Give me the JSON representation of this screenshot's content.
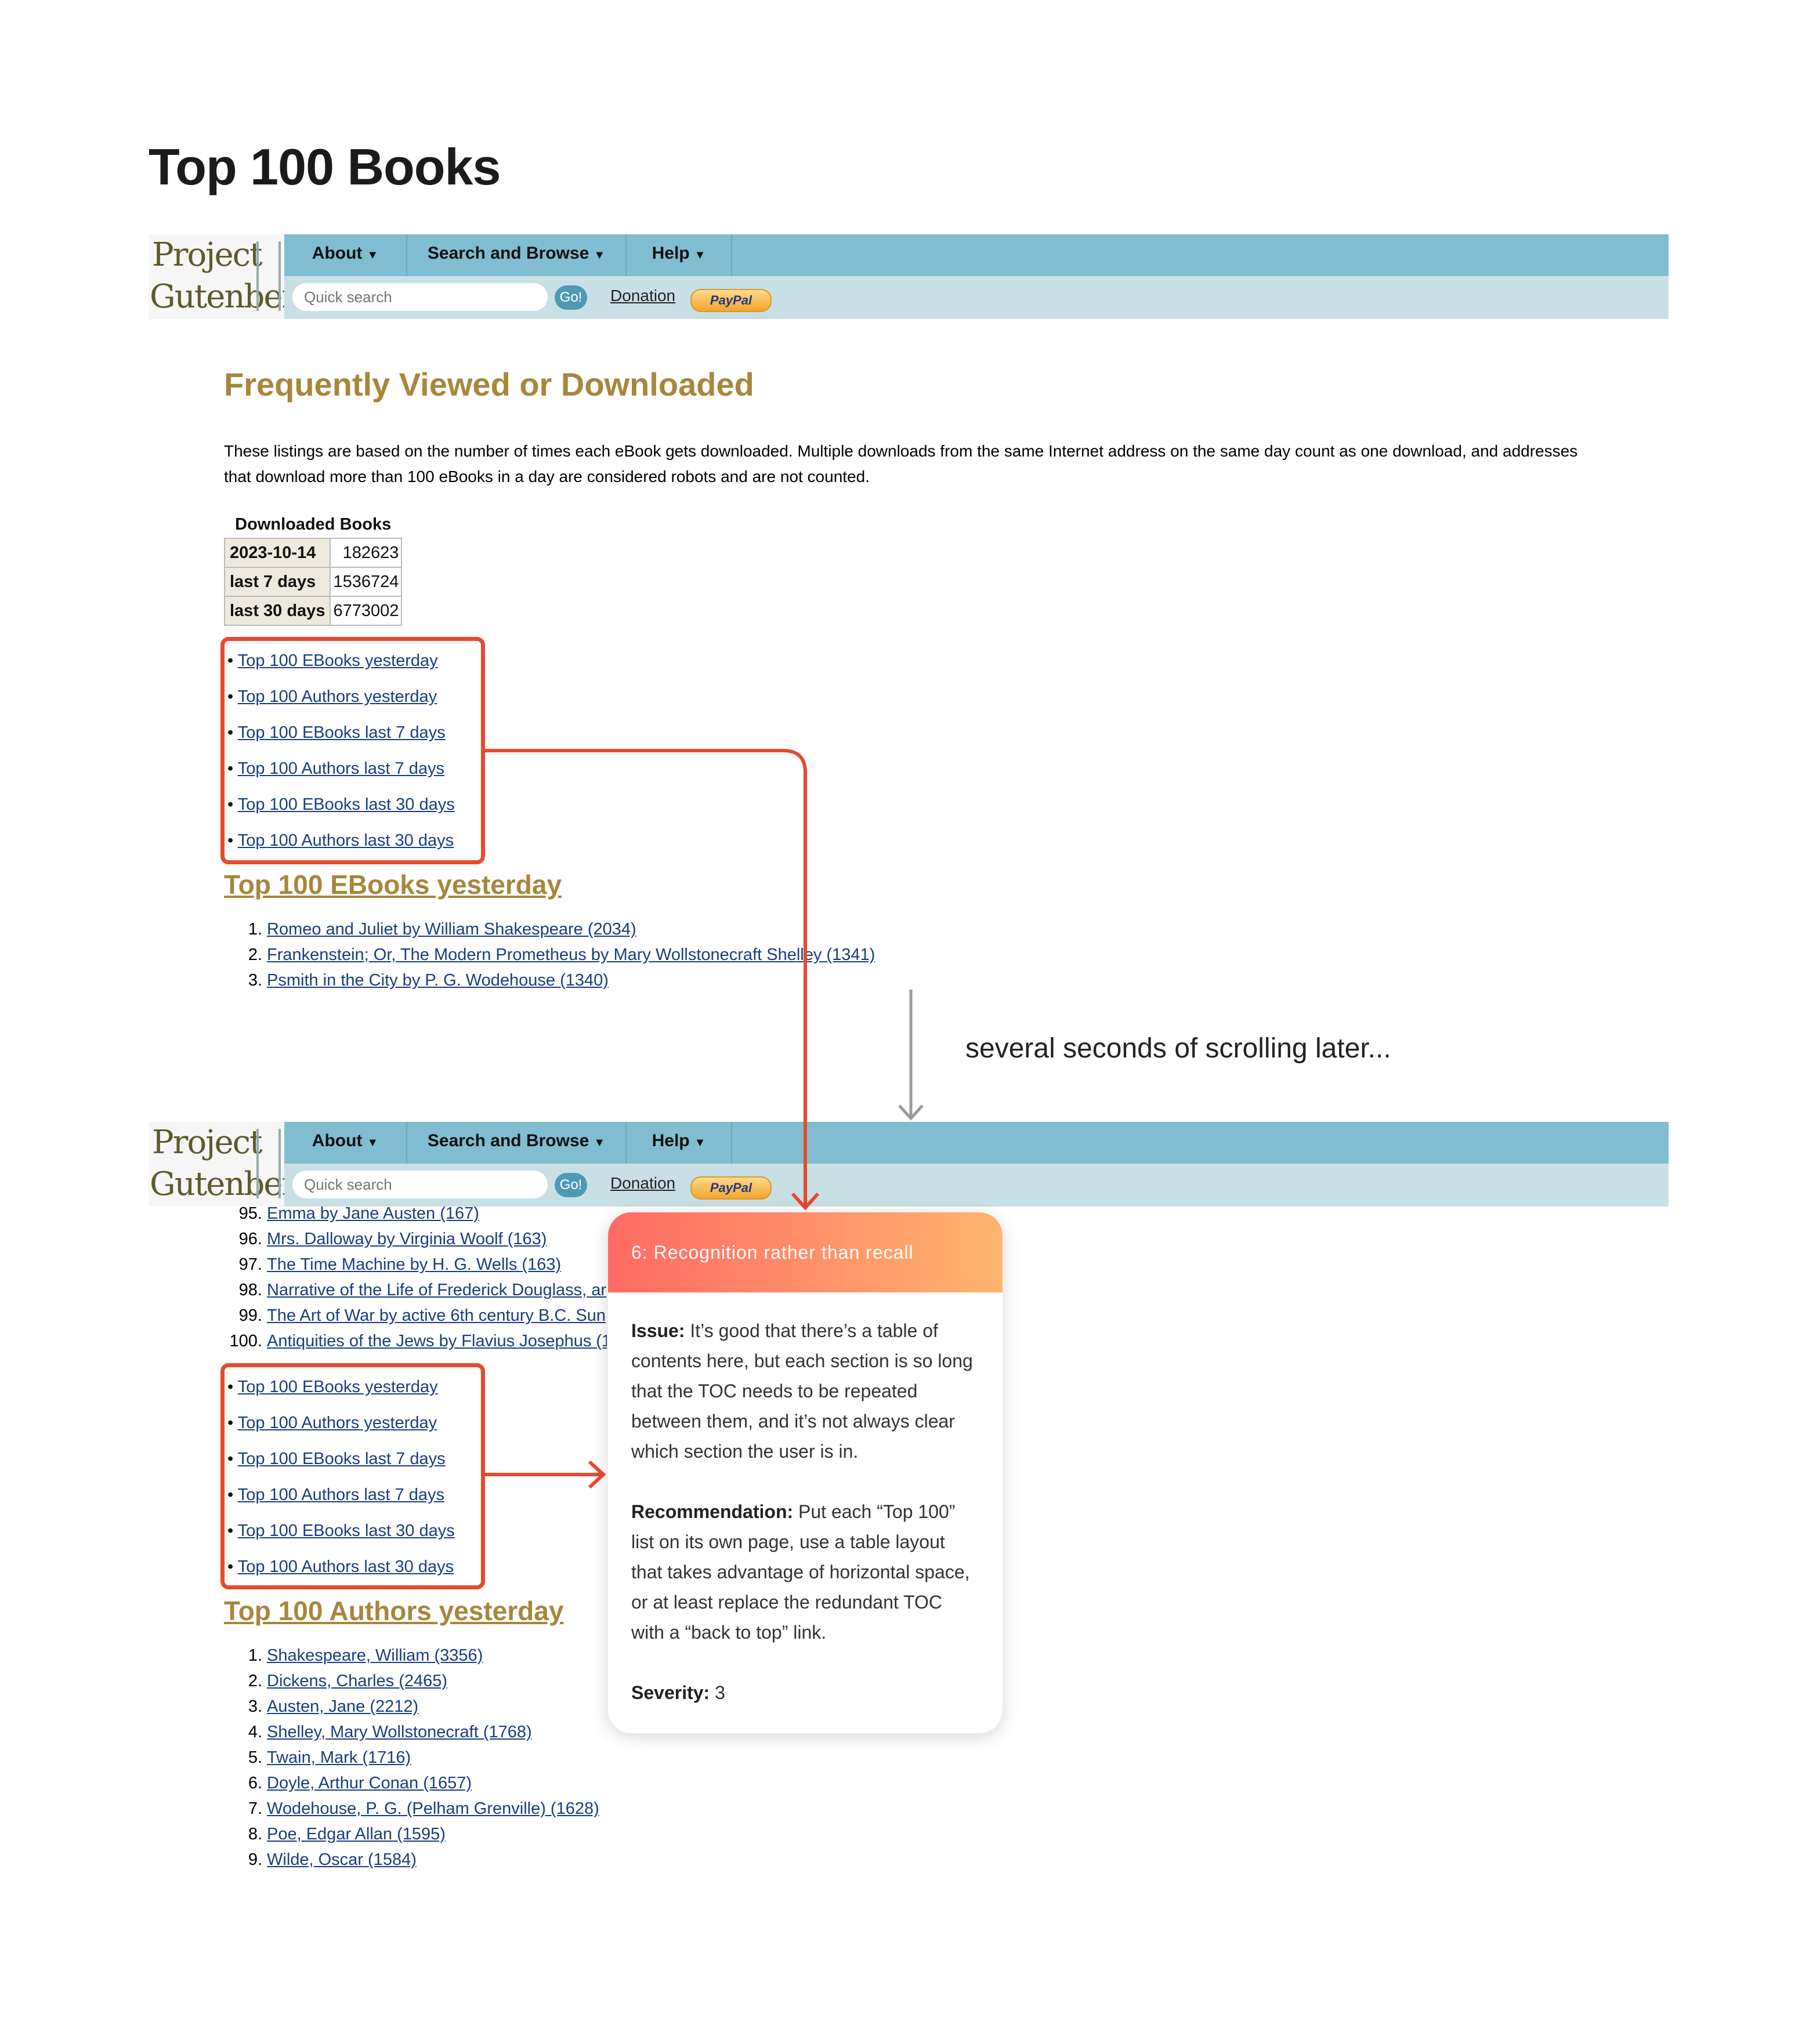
{
  "page_title": "Top 100 Books",
  "gutenberg": {
    "logo_line1": "Project",
    "logo_line2": "Gutenberg",
    "nav": [
      "About",
      "Search and Browse",
      "Help"
    ],
    "search_placeholder": "Quick search",
    "go_label": "Go!",
    "donation_label": "Donation",
    "paypal_label": "PayPal"
  },
  "section_title": "Frequently Viewed or Downloaded",
  "intro_text": "These listings are based on the number of times each eBook gets downloaded. Multiple downloads from the same Internet address on the same day count as one download, and addresses that download more than 100 eBooks in a day are considered robots and are not counted.",
  "downloads": {
    "caption": "Downloaded Books",
    "rows": [
      {
        "label": "2023-10-14",
        "value": "182623"
      },
      {
        "label": "last 7 days",
        "value": "1536724"
      },
      {
        "label": "last 30 days",
        "value": "6773002"
      }
    ]
  },
  "toc": [
    "Top 100 EBooks yesterday",
    "Top 100 Authors yesterday",
    "Top 100 EBooks last 7 days",
    "Top 100 Authors last 7 days",
    "Top 100 EBooks last 30 days",
    "Top 100 Authors last 30 days"
  ],
  "ebooks_heading": "Top 100 EBooks yesterday",
  "ebooks_top": [
    {
      "num": "1.",
      "text": "Romeo and Juliet by William Shakespeare (2034)"
    },
    {
      "num": "2.",
      "text": "Frankenstein; Or, The Modern Prometheus by Mary Wollstonecraft Shelley (1341)"
    },
    {
      "num": "3.",
      "text": "Psmith in the City by P. G. Wodehouse (1340)"
    }
  ],
  "scroll_note": "several seconds of scrolling later...",
  "ebooks_bottom": [
    {
      "num": "95.",
      "text": "Emma by Jane Austen (167)"
    },
    {
      "num": "96.",
      "text": "Mrs. Dalloway by Virginia Woolf (163)"
    },
    {
      "num": "97.",
      "text": "The Time Machine by H. G. Wells (163)"
    },
    {
      "num": "98.",
      "text": "Narrative of the Life of Frederick Douglass, ar"
    },
    {
      "num": "99.",
      "text": "The Art of War by active 6th century B.C. Sun"
    },
    {
      "num": "100.",
      "text": "Antiquities of the Jews by Flavius Josephus (1"
    }
  ],
  "authors_heading": "Top 100 Authors yesterday",
  "authors": [
    {
      "num": "1.",
      "text": "Shakespeare, William (3356)"
    },
    {
      "num": "2.",
      "text": "Dickens, Charles (2465)"
    },
    {
      "num": "3.",
      "text": "Austen, Jane (2212)"
    },
    {
      "num": "4.",
      "text": "Shelley, Mary Wollstonecraft (1768)"
    },
    {
      "num": "5.",
      "text": "Twain, Mark (1716)"
    },
    {
      "num": "6.",
      "text": "Doyle, Arthur Conan (1657)"
    },
    {
      "num": "7.",
      "text": "Wodehouse, P. G. (Pelham Grenville) (1628)"
    },
    {
      "num": "8.",
      "text": "Poe, Edgar Allan (1595)"
    },
    {
      "num": "9.",
      "text": "Wilde, Oscar (1584)"
    }
  ],
  "card": {
    "title": "6: Recognition rather than recall",
    "issue_label": "Issue:",
    "issue_text": " It’s good that there’s a table of contents here, but each section is so long that the TOC needs to be repeated between them, and it’s not always clear which section the user is in.",
    "rec_label": "Recommendation:",
    "rec_text": " Put each “Top 100” list on its own page, use a table layout that takes advantage of horizontal space, or at least replace the redundant TOC with a “back to top” link.",
    "severity_label": "Severity:",
    "severity_value": " 3"
  },
  "colors": {
    "accent_red": "#e84a2e",
    "gutenberg_nav": "#80bdd1",
    "gutenberg_subbar": "#c9dfe6",
    "heading_gold": "#a8863c",
    "link_blue": "#1a3d80"
  }
}
